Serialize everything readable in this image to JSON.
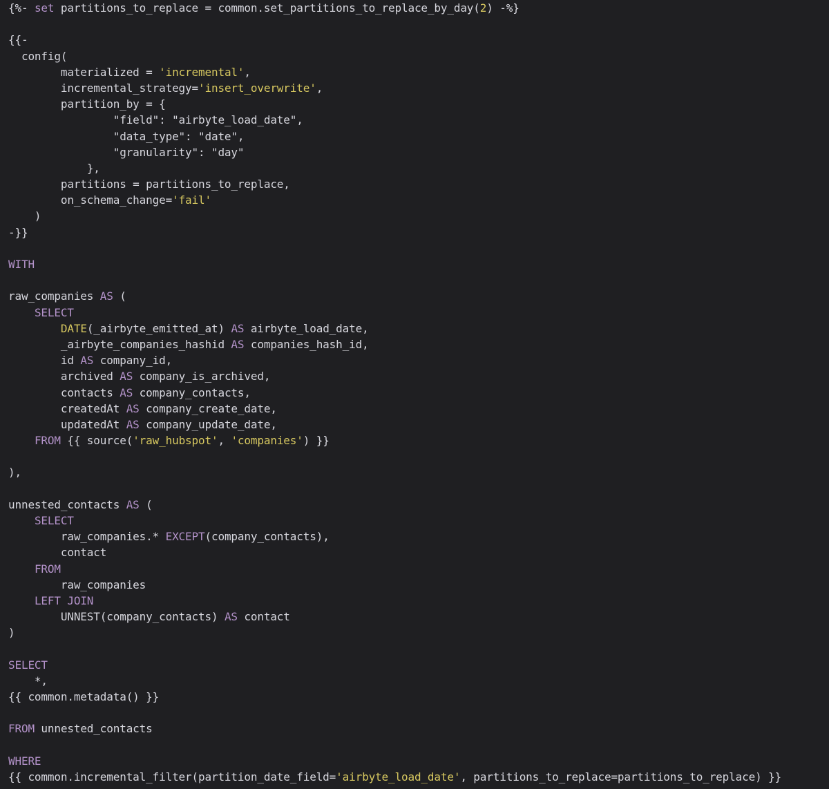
{
  "colors": {
    "background": "#1f1f22",
    "text": "#d6d6dd",
    "keyword": "#b392c9",
    "string": "#d7c860"
  },
  "lines": [
    [
      [
        "plain",
        "{%- "
      ],
      [
        "kw",
        "set"
      ],
      [
        "plain",
        " partitions_to_replace = common.set_partitions_to_replace_by_day("
      ],
      [
        "num",
        "2"
      ],
      [
        "plain",
        ") -%}"
      ]
    ],
    [],
    [
      [
        "plain",
        "{{-"
      ]
    ],
    [
      [
        "plain",
        "  config("
      ]
    ],
    [
      [
        "plain",
        "        materialized = "
      ],
      [
        "str",
        "'incremental'"
      ],
      [
        "plain",
        ","
      ]
    ],
    [
      [
        "plain",
        "        incremental_strategy="
      ],
      [
        "str",
        "'insert_overwrite'"
      ],
      [
        "plain",
        ","
      ]
    ],
    [
      [
        "plain",
        "        partition_by = {"
      ]
    ],
    [
      [
        "plain",
        "                \"field\": \"airbyte_load_date\","
      ]
    ],
    [
      [
        "plain",
        "                \"data_type\": \"date\","
      ]
    ],
    [
      [
        "plain",
        "                \"granularity\": \"day\""
      ]
    ],
    [
      [
        "plain",
        "            },"
      ]
    ],
    [
      [
        "plain",
        "        partitions = partitions_to_replace,"
      ]
    ],
    [
      [
        "plain",
        "        on_schema_change="
      ],
      [
        "str",
        "'fail'"
      ]
    ],
    [
      [
        "plain",
        "    )"
      ]
    ],
    [
      [
        "plain",
        "-}}"
      ]
    ],
    [],
    [
      [
        "kw",
        "WITH"
      ]
    ],
    [],
    [
      [
        "plain",
        "raw_companies "
      ],
      [
        "kw",
        "AS"
      ],
      [
        "plain",
        " ("
      ]
    ],
    [
      [
        "plain",
        "    "
      ],
      [
        "kw",
        "SELECT"
      ]
    ],
    [
      [
        "plain",
        "        "
      ],
      [
        "str",
        "DATE"
      ],
      [
        "plain",
        "(_airbyte_emitted_at) "
      ],
      [
        "kw",
        "AS"
      ],
      [
        "plain",
        " airbyte_load_date,"
      ]
    ],
    [
      [
        "plain",
        "        _airbyte_companies_hashid "
      ],
      [
        "kw",
        "AS"
      ],
      [
        "plain",
        " companies_hash_id,"
      ]
    ],
    [
      [
        "plain",
        "        id "
      ],
      [
        "kw",
        "AS"
      ],
      [
        "plain",
        " company_id,"
      ]
    ],
    [
      [
        "plain",
        "        archived "
      ],
      [
        "kw",
        "AS"
      ],
      [
        "plain",
        " company_is_archived,"
      ]
    ],
    [
      [
        "plain",
        "        contacts "
      ],
      [
        "kw",
        "AS"
      ],
      [
        "plain",
        " company_contacts,"
      ]
    ],
    [
      [
        "plain",
        "        createdAt "
      ],
      [
        "kw",
        "AS"
      ],
      [
        "plain",
        " company_create_date,"
      ]
    ],
    [
      [
        "plain",
        "        updatedAt "
      ],
      [
        "kw",
        "AS"
      ],
      [
        "plain",
        " company_update_date,"
      ]
    ],
    [
      [
        "plain",
        "    "
      ],
      [
        "kw",
        "FROM"
      ],
      [
        "plain",
        " {{ source("
      ],
      [
        "str",
        "'raw_hubspot'"
      ],
      [
        "plain",
        ", "
      ],
      [
        "str",
        "'companies'"
      ],
      [
        "plain",
        ") }}"
      ]
    ],
    [],
    [
      [
        "plain",
        "),"
      ]
    ],
    [],
    [
      [
        "plain",
        "unnested_contacts "
      ],
      [
        "kw",
        "AS"
      ],
      [
        "plain",
        " ("
      ]
    ],
    [
      [
        "plain",
        "    "
      ],
      [
        "kw",
        "SELECT"
      ]
    ],
    [
      [
        "plain",
        "        raw_companies.* "
      ],
      [
        "kw",
        "EXCEPT"
      ],
      [
        "plain",
        "(company_contacts),"
      ]
    ],
    [
      [
        "plain",
        "        contact"
      ]
    ],
    [
      [
        "plain",
        "    "
      ],
      [
        "kw",
        "FROM"
      ]
    ],
    [
      [
        "plain",
        "        raw_companies"
      ]
    ],
    [
      [
        "plain",
        "    "
      ],
      [
        "kw",
        "LEFT JOIN"
      ]
    ],
    [
      [
        "plain",
        "        UNNEST(company_contacts) "
      ],
      [
        "kw",
        "AS"
      ],
      [
        "plain",
        " contact"
      ]
    ],
    [
      [
        "plain",
        ")"
      ]
    ],
    [],
    [
      [
        "kw",
        "SELECT"
      ]
    ],
    [
      [
        "plain",
        "    *,"
      ]
    ],
    [
      [
        "plain",
        "{{ common.metadata() }}"
      ]
    ],
    [],
    [
      [
        "kw",
        "FROM"
      ],
      [
        "plain",
        " unnested_contacts"
      ]
    ],
    [],
    [
      [
        "kw",
        "WHERE"
      ]
    ],
    [
      [
        "plain",
        "{{ common.incremental_filter(partition_date_field="
      ],
      [
        "str",
        "'airbyte_load_date'"
      ],
      [
        "plain",
        ", partitions_to_replace=partitions_to_replace) }}"
      ]
    ]
  ]
}
